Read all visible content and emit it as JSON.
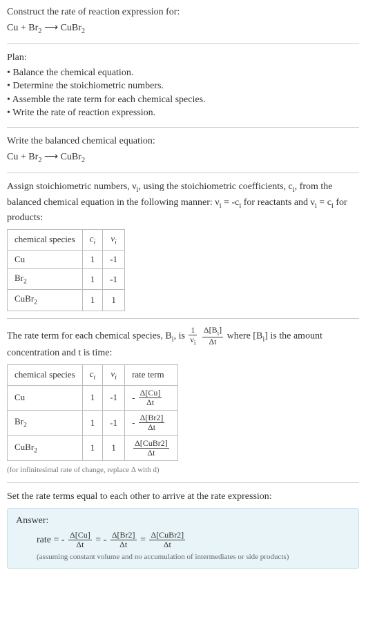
{
  "prompt": {
    "line1": "Construct the rate of reaction expression for:",
    "equation_lhs": "Cu + Br",
    "equation_br_sub": "2",
    "arrow": " ⟶ ",
    "equation_rhs": "CuBr",
    "equation_cubr_sub": "2"
  },
  "plan": {
    "heading": "Plan:",
    "items": [
      "Balance the chemical equation.",
      "Determine the stoichiometric numbers.",
      "Assemble the rate term for each chemical species.",
      "Write the rate of reaction expression."
    ]
  },
  "balanced": {
    "heading": "Write the balanced chemical equation:"
  },
  "stoich": {
    "intro_a": "Assign stoichiometric numbers, ν",
    "intro_a_sub": "i",
    "intro_b": ", using the stoichiometric coefficients, c",
    "intro_b_sub": "i",
    "intro_c": ", from the balanced chemical equation in the following manner: ν",
    "intro_c_sub": "i",
    "intro_d": " = -c",
    "intro_d_sub": "i",
    "intro_e": " for reactants and ν",
    "intro_e_sub": "i",
    "intro_f": " = c",
    "intro_f_sub": "i",
    "intro_g": " for products:",
    "headers": {
      "species": "chemical species",
      "ci": "cᵢ",
      "vi": "νᵢ"
    },
    "rows": [
      {
        "species": "Cu",
        "ci": "1",
        "vi": "-1"
      },
      {
        "species_a": "Br",
        "species_sub": "2",
        "ci": "1",
        "vi": "-1"
      },
      {
        "species_a": "CuBr",
        "species_sub": "2",
        "ci": "1",
        "vi": "1"
      }
    ]
  },
  "rateterm": {
    "intro_a": "The rate term for each chemical species, B",
    "intro_a_sub": "i",
    "intro_b": ", is ",
    "frac1_num": "1",
    "frac1_den_a": "ν",
    "frac1_den_sub": "i",
    "frac2_num_a": "Δ[B",
    "frac2_num_sub": "i",
    "frac2_num_b": "]",
    "frac2_den": "Δt",
    "intro_c": " where [B",
    "intro_c_sub": "i",
    "intro_d": "] is the amount concentration and t is time:",
    "headers": {
      "species": "chemical species",
      "ci": "cᵢ",
      "vi": "νᵢ",
      "rate": "rate term"
    },
    "rows": [
      {
        "species": "Cu",
        "ci": "1",
        "vi": "-1",
        "neg": "-",
        "num": "Δ[Cu]",
        "den": "Δt"
      },
      {
        "species_a": "Br",
        "species_sub": "2",
        "ci": "1",
        "vi": "-1",
        "neg": "-",
        "num": "Δ[Br2]",
        "den": "Δt"
      },
      {
        "species_a": "CuBr",
        "species_sub": "2",
        "ci": "1",
        "vi": "1",
        "neg": "",
        "num": "Δ[CuBr2]",
        "den": "Δt"
      }
    ],
    "footnote": "(for infinitesimal rate of change, replace Δ with d)"
  },
  "final": {
    "heading": "Set the rate terms equal to each other to arrive at the rate expression:"
  },
  "answer": {
    "label": "Answer:",
    "rate_prefix": "rate = ",
    "neg1": "-",
    "t1_num": "Δ[Cu]",
    "t1_den": "Δt",
    "eq": " = ",
    "neg2": "-",
    "t2_num": "Δ[Br2]",
    "t2_den": "Δt",
    "t3_num": "Δ[CuBr2]",
    "t3_den": "Δt",
    "note": "(assuming constant volume and no accumulation of intermediates or side products)"
  },
  "chart_data": {
    "type": "table",
    "tables": [
      {
        "title": "Stoichiometric numbers",
        "columns": [
          "chemical species",
          "c_i",
          "ν_i"
        ],
        "rows": [
          [
            "Cu",
            1,
            -1
          ],
          [
            "Br2",
            1,
            -1
          ],
          [
            "CuBr2",
            1,
            1
          ]
        ]
      },
      {
        "title": "Rate terms",
        "columns": [
          "chemical species",
          "c_i",
          "ν_i",
          "rate term"
        ],
        "rows": [
          [
            "Cu",
            1,
            -1,
            "-Δ[Cu]/Δt"
          ],
          [
            "Br2",
            1,
            -1,
            "-Δ[Br2]/Δt"
          ],
          [
            "CuBr2",
            1,
            1,
            "Δ[CuBr2]/Δt"
          ]
        ]
      }
    ]
  }
}
